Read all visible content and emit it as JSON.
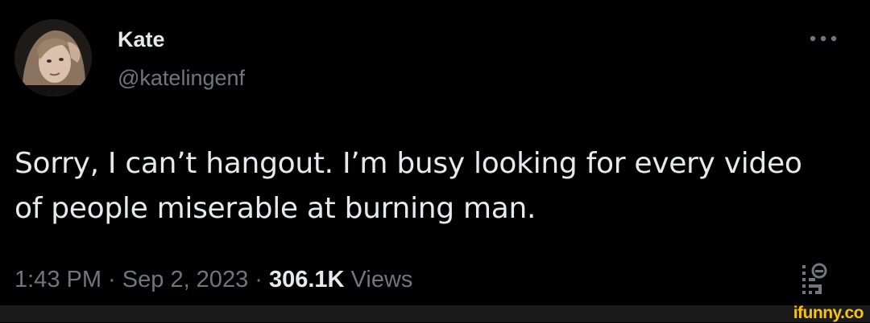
{
  "author": {
    "name": "Kate",
    "handle": "@katelingenf"
  },
  "tweet": {
    "line1": "Sorry, I can’t hangout. I’m busy looking for every video",
    "line2": "of people miserable at burning man."
  },
  "meta": {
    "time": "1:43 PM",
    "separator1": " · ",
    "date": "Sep 2, 2023",
    "separator2": " · ",
    "views_count": "306.1K",
    "views_label": " Views"
  },
  "watermark": "ifunny.co",
  "icons": {
    "more": "more-options-icon",
    "analytics": "analytics-icon"
  },
  "colors": {
    "background": "#000000",
    "primary_text": "#e7e9ea",
    "secondary_text": "#71767b",
    "watermark": "#f6c30f"
  }
}
